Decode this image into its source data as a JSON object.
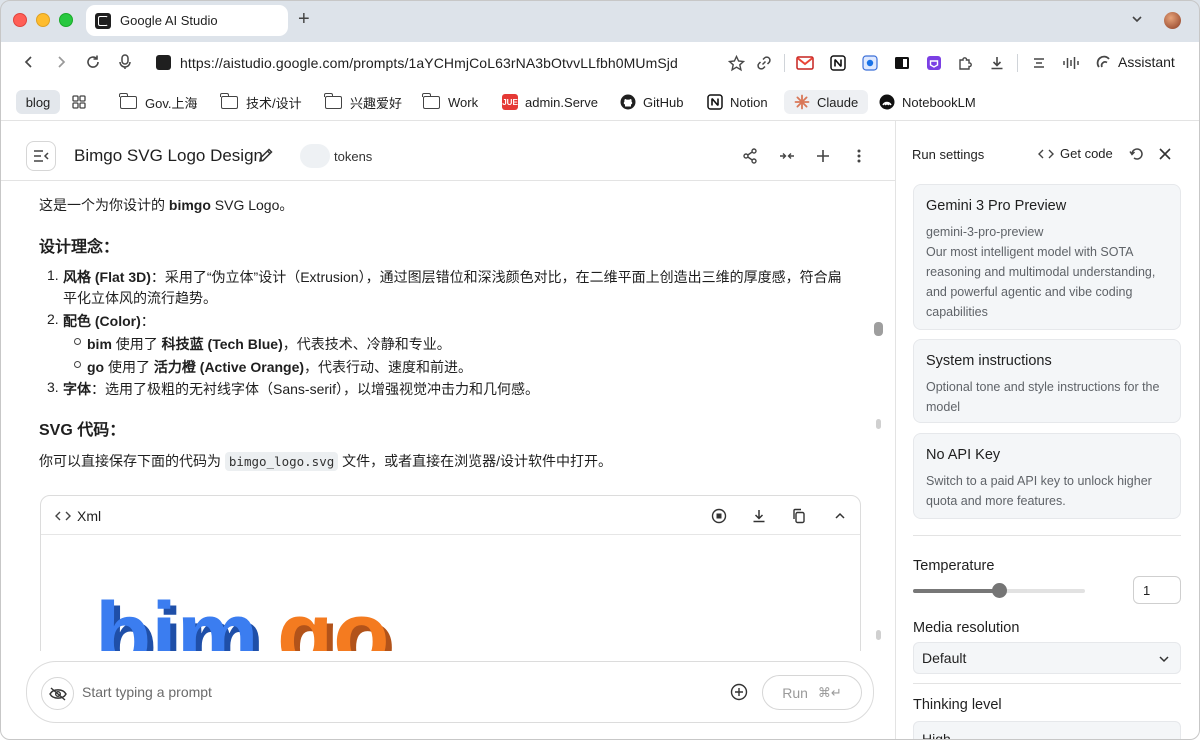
{
  "browser": {
    "tab_title": "Google AI Studio",
    "new_tab_symbol": "+",
    "url": "https://aistudio.google.com/prompts/1aYCHmjCoL63rNA3bOtvvLLfbh0MUmSjd",
    "assistant_label": "Assistant"
  },
  "bookmarks": {
    "blog": "blog",
    "gov": "Gov.上海",
    "tech": "技术/设计",
    "hobby": "兴趣爱好",
    "work": "Work",
    "admin_badge": "JUE",
    "admin": "admin.Serve",
    "github": "GitHub",
    "notion": "Notion",
    "claude": "Claude",
    "notebooklm": "NotebookLM"
  },
  "header": {
    "title": "Bimgo SVG Logo Design",
    "tokens_label": "tokens"
  },
  "chat": {
    "intro_pre": "这是一个为你设计的 ",
    "intro_bold": "bimgo",
    "intro_post": " SVG Logo。",
    "concept_heading": "设计理念：",
    "item1_num": "1.",
    "item1_bold": "风格 (Flat 3D)",
    "item1_text_a": "：采用了“伪立体”设计（Extrusion），通过图层错位和深浅颜色对比，在二维平面上创造出三维的厚度感，符合扁",
    "item1_text_b": "平化立体风的流行趋势。",
    "item2_num": "2.",
    "item2_bold": "配色 (Color)",
    "item2_colon": "：",
    "sub1_bold_a": "bim",
    "sub1_mid": " 使用了 ",
    "sub1_bold_b": "科技蓝 (Tech Blue)",
    "sub1_post": "，代表技术、冷静和专业。",
    "sub2_bold_a": "go",
    "sub2_mid": " 使用了 ",
    "sub2_bold_b": "活力橙 (Active Orange)",
    "sub2_post": "，代表行动、速度和前进。",
    "item3_num": "3.",
    "item3_bold": "字体",
    "item3_text": "：选用了极粗的无衬线字体（Sans-serif），以增强视觉冲击力和几何感。",
    "svg_heading": "SVG 代码：",
    "save_pre": "你可以直接保存下面的代码为 ",
    "save_code": "bimgo_logo.svg",
    "save_post": " 文件，或者直接在浏览器/设计软件中打开。",
    "code_lang": "Xml",
    "logo_part1": "bim",
    "logo_part2": "go"
  },
  "input": {
    "placeholder": "Start typing a prompt",
    "run_label": "Run",
    "run_shortcut": "⌘↵"
  },
  "settings": {
    "title": "Run settings",
    "get_code": "Get code",
    "model_name": "Gemini 3 Pro Preview",
    "model_id": "gemini-3-pro-preview",
    "model_desc": "Our most intelligent model with SOTA reasoning and multimodal understanding, and powerful agentic and vibe coding capabilities",
    "sys_title": "System instructions",
    "sys_desc": "Optional tone and style instructions for the model",
    "api_title": "No API Key",
    "api_desc": "Switch to a paid API key to unlock higher quota and more features.",
    "temperature_label": "Temperature",
    "temperature_value": "1",
    "temperature_fraction": 0.5,
    "media_label": "Media resolution",
    "media_value": "Default",
    "thinking_label": "Thinking level",
    "thinking_value": "High"
  },
  "colors": {
    "tech_blue": "#2f6fe0",
    "active_orange": "#f47b20"
  }
}
